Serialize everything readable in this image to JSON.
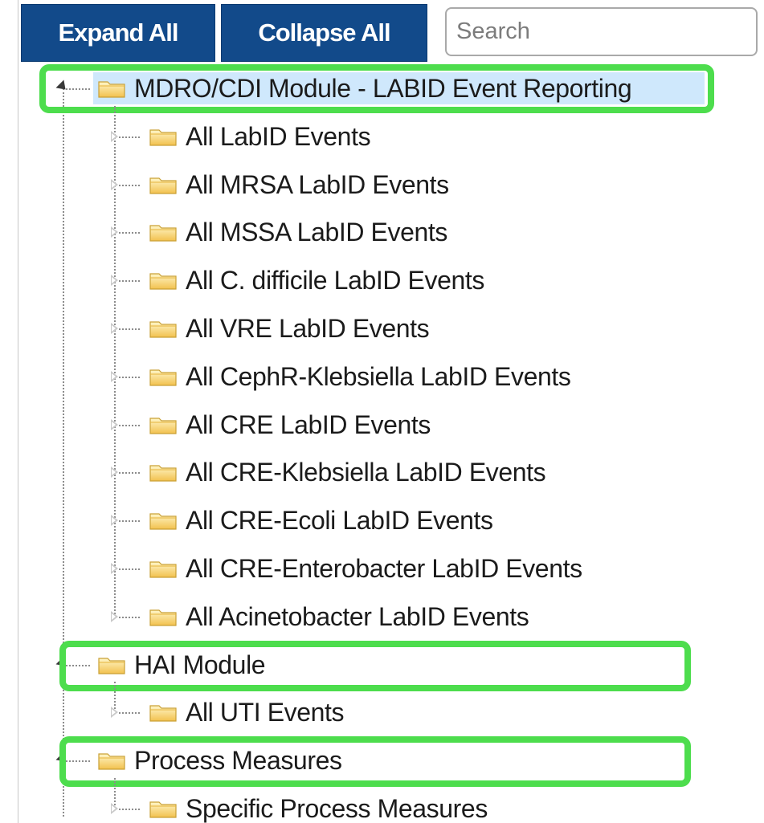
{
  "toolbar": {
    "expand_all_label": "Expand All",
    "collapse_all_label": "Collapse All",
    "search_placeholder": "Search",
    "button_color": "#124a8a"
  },
  "tree": {
    "selection_color": "#cfe8fc",
    "highlight_color": "#4ddd4d",
    "folder_icon": "folder-icon",
    "groups": [
      {
        "label": "MDRO/CDI Module - LABID Event Reporting",
        "expanded": true,
        "selected": true,
        "highlighted": true,
        "children": [
          "All LabID Events",
          "All MRSA LabID Events",
          "All MSSA LabID Events",
          "All C. difficile LabID Events",
          "All VRE LabID Events",
          "All CephR-Klebsiella LabID Events",
          "All CRE LabID Events",
          "All CRE-Klebsiella LabID Events",
          "All CRE-Ecoli LabID Events",
          "All CRE-Enterobacter LabID Events",
          "All Acinetobacter LabID Events"
        ]
      },
      {
        "label": "HAI Module",
        "expanded": true,
        "selected": false,
        "highlighted": true,
        "children": [
          "All UTI Events"
        ]
      },
      {
        "label": "Process Measures",
        "expanded": true,
        "selected": false,
        "highlighted": true,
        "children": [
          "Specific Process Measures"
        ]
      }
    ]
  }
}
